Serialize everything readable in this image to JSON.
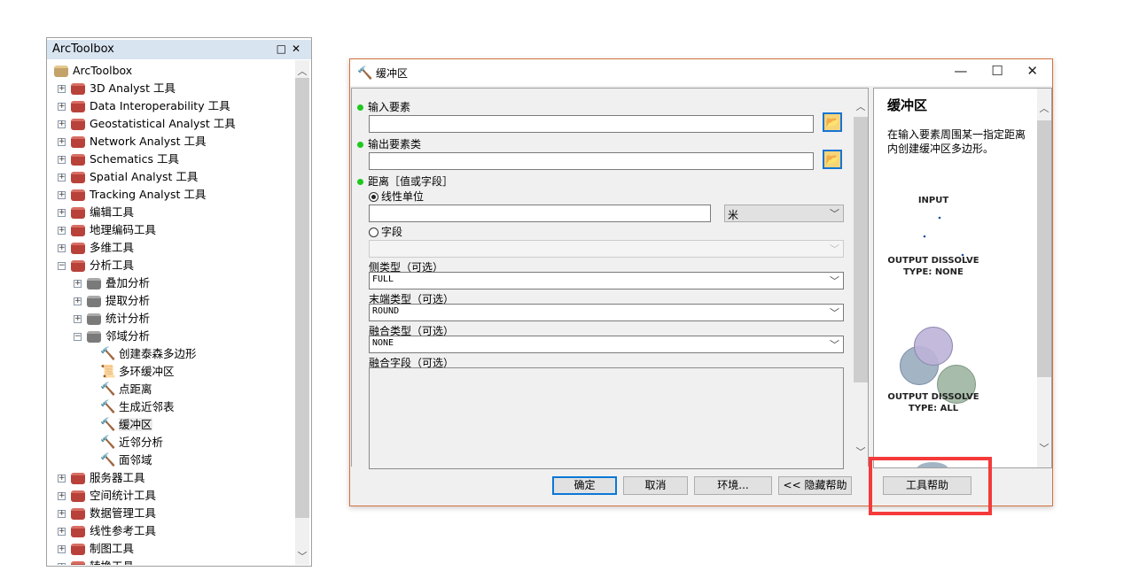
{
  "toolbox": {
    "title": "ArcToolbox",
    "root": "ArcToolbox",
    "items": [
      {
        "label": "3D Analyst 工具",
        "state": "collapsed"
      },
      {
        "label": "Data Interoperability 工具",
        "state": "collapsed"
      },
      {
        "label": "Geostatistical Analyst 工具",
        "state": "collapsed"
      },
      {
        "label": "Network Analyst 工具",
        "state": "collapsed"
      },
      {
        "label": "Schematics 工具",
        "state": "collapsed"
      },
      {
        "label": "Spatial Analyst 工具",
        "state": "collapsed"
      },
      {
        "label": "Tracking Analyst 工具",
        "state": "collapsed"
      },
      {
        "label": "编辑工具",
        "state": "collapsed"
      },
      {
        "label": "地理编码工具",
        "state": "collapsed"
      },
      {
        "label": "多维工具",
        "state": "collapsed"
      },
      {
        "label": "分析工具",
        "state": "expanded"
      }
    ],
    "analysis_sets": [
      "叠加分析",
      "提取分析",
      "统计分析",
      "邻域分析"
    ],
    "neighborhood_tools": [
      "创建泰森多边形",
      "多环缓冲区",
      "点距离",
      "生成近邻表",
      "缓冲区",
      "近邻分析",
      "面邻域"
    ],
    "selected_tool": "缓冲区",
    "items_after": [
      "服务器工具",
      "空间统计工具",
      "数据管理工具",
      "线性参考工具",
      "制图工具",
      "转换工具"
    ]
  },
  "dialog": {
    "title": "缓冲区",
    "input_features_label": "输入要素",
    "input_features_value": "",
    "output_class_label": "输出要素类",
    "output_class_value": "",
    "distance_label": "距离［值或字段］",
    "linear_unit_label": "线性单位",
    "linear_unit_value": "",
    "unit_value": "米",
    "field_label": "字段",
    "side_type_label": "侧类型（可选）",
    "side_type_value": "FULL",
    "end_type_label": "末端类型（可选）",
    "end_type_value": "ROUND",
    "dissolve_type_label": "融合类型（可选）",
    "dissolve_type_value": "NONE",
    "dissolve_field_label": "融合字段（可选）",
    "buttons": {
      "ok": "确定",
      "cancel": "取消",
      "env": "环境...",
      "hide_help": "<< 隐藏帮助",
      "tool_help": "工具帮助"
    }
  },
  "help": {
    "title": "缓冲区",
    "description": "在输入要素周围某一指定距离内创建缓冲区多边形。",
    "input_caption": "INPUT",
    "output_none_caption": "OUTPUT DISSOLVE TYPE: NONE",
    "output_all_caption": "OUTPUT DISSOLVE TYPE: ALL"
  },
  "colors": {
    "highlight_box": "#f43a3a",
    "required_dot": "#1ec81e",
    "window_border": "#d5713e",
    "default_button": "#0a78d7"
  }
}
